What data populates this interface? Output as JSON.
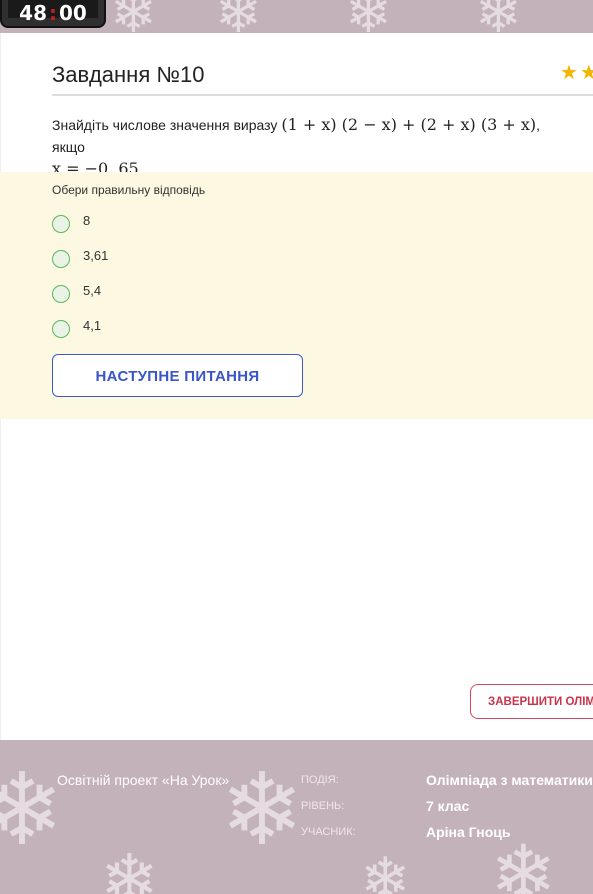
{
  "timer": {
    "minutes": "48",
    "separator": ":",
    "seconds": "00"
  },
  "task": {
    "title": "Завдання №10",
    "question_prefix": "Знайдіть числове значення виразу ",
    "expression": "(1 + x) (2 − x) + (2 + x) (3 + x)",
    "question_mid": ", якщо",
    "condition": "x = −0, 65",
    "question_end": "."
  },
  "stars": "★★",
  "answers": {
    "instruction": "Обери правильну відповідь",
    "options": [
      "8",
      "3,61",
      "5,4",
      "4,1"
    ]
  },
  "buttons": {
    "next": "НАСТУПНЕ ПИТАННЯ",
    "finish": "ЗАВЕРШИТИ ОЛІМПІАДУ"
  },
  "footer": {
    "project": "Освітній проект «На Урок»",
    "event_label": "ПОДІЯ:",
    "event_value": "Олімпіада з математики",
    "level_label": "РІВЕНЬ:",
    "level_value": "7 клас",
    "participant_label": "УЧАСНИК:",
    "participant_value": "Аріна Гноць"
  },
  "colors": {
    "header_band": "#c4b2ba",
    "answer_panel": "#fdf8e2",
    "next_button": "#3b55c9",
    "finish_button": "#c9344c",
    "radio": "#5cb85c",
    "star": "#f5b400"
  }
}
